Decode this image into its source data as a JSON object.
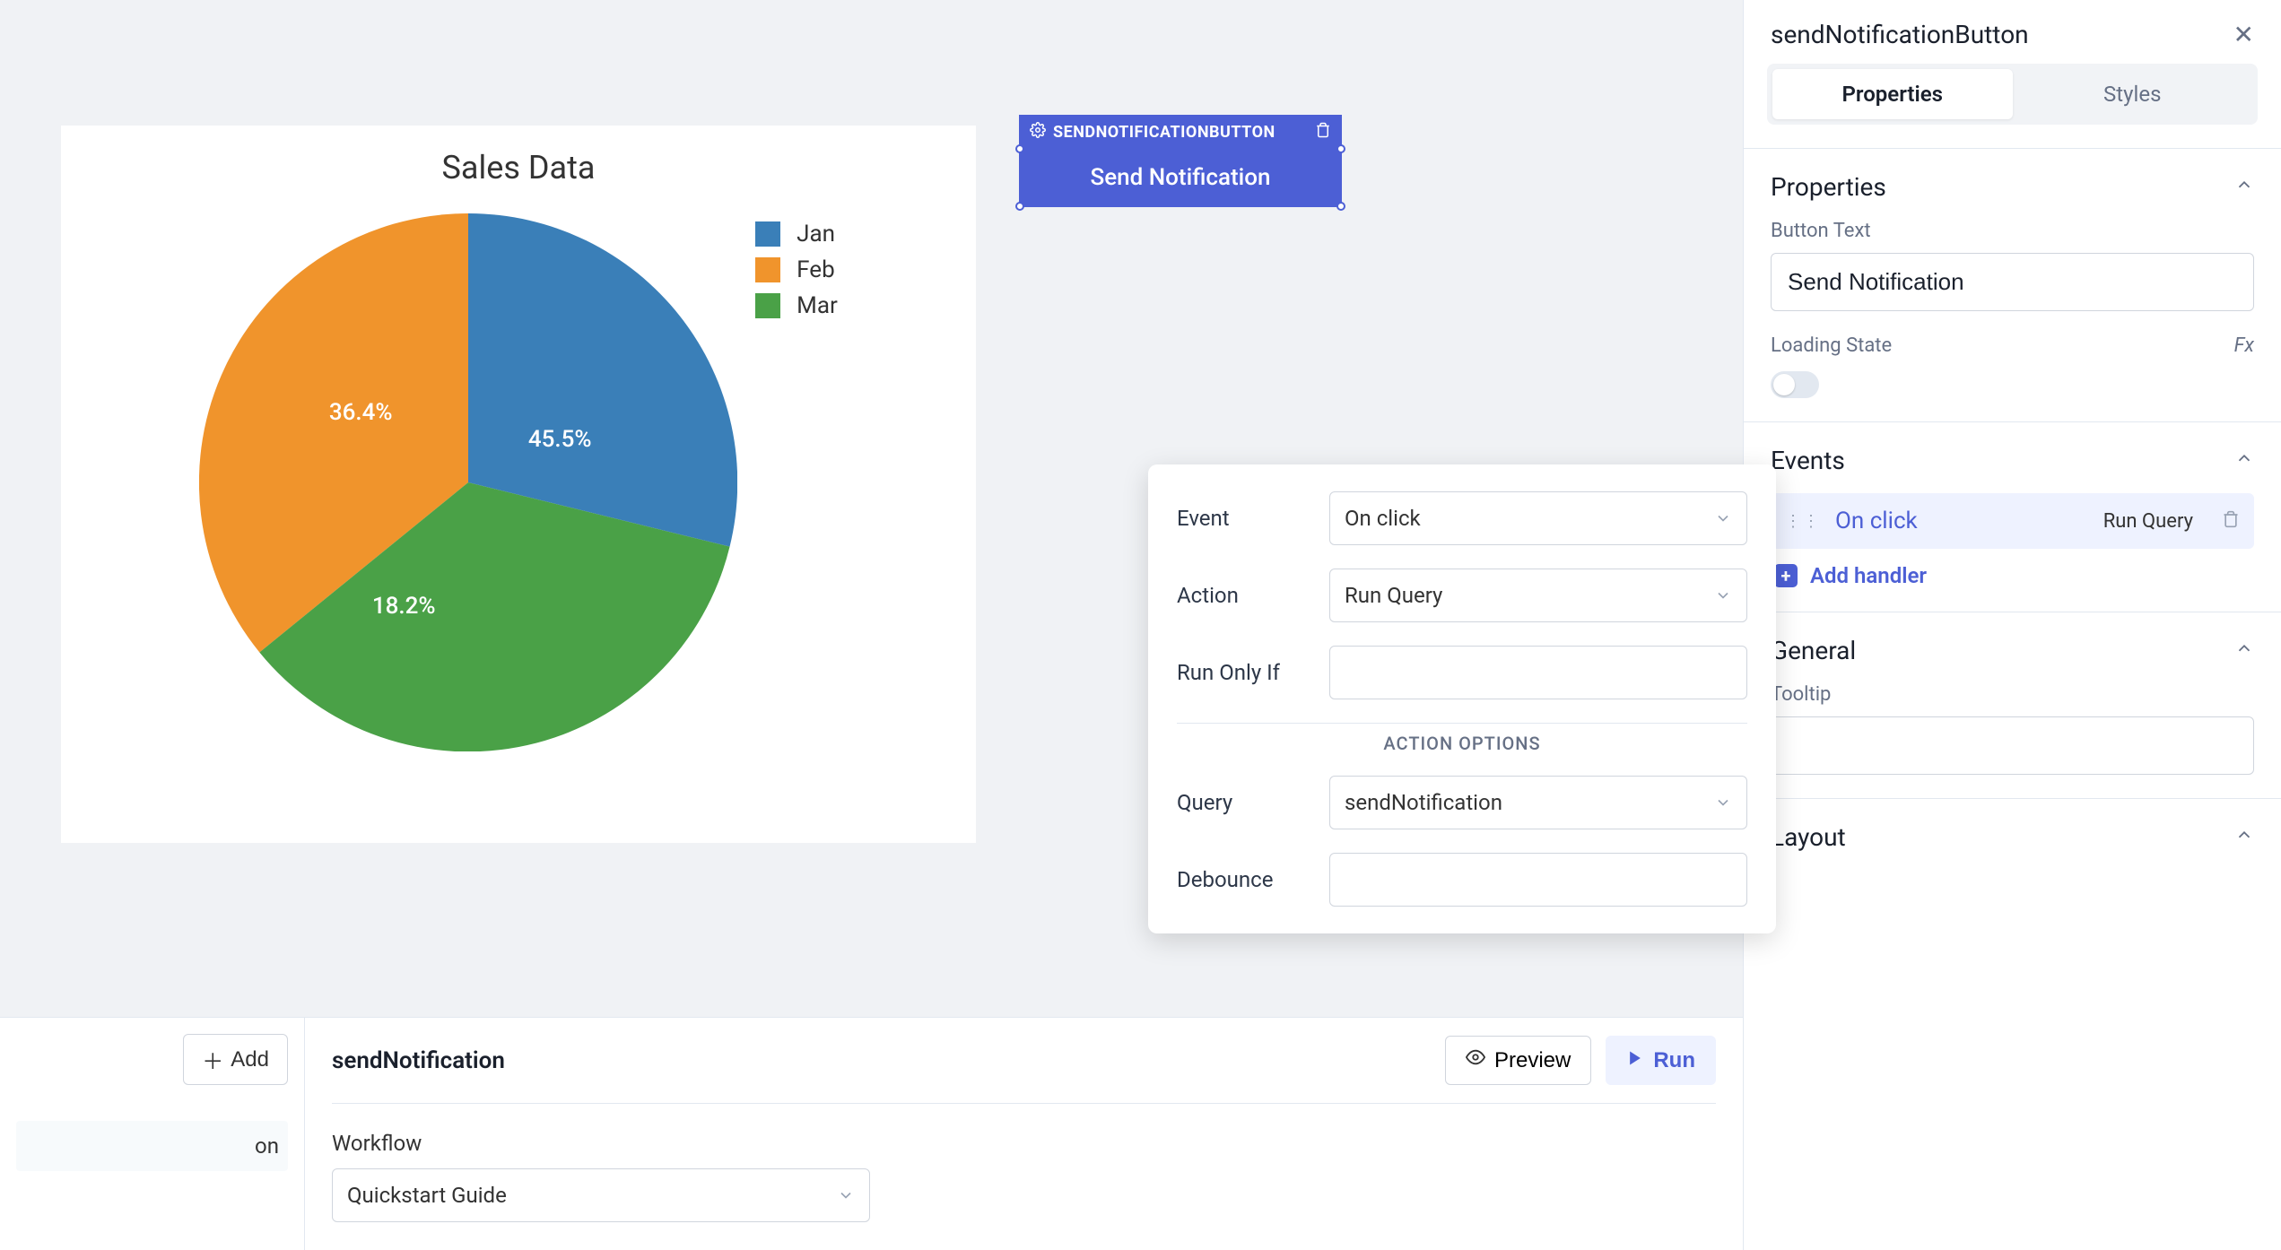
{
  "chart_data": {
    "type": "pie",
    "title": "Sales Data",
    "series": [
      {
        "name": "Jan",
        "value": 45.5,
        "color": "#3a7fb8",
        "label": "45.5%"
      },
      {
        "name": "Feb",
        "value": 36.4,
        "color": "#f0942c",
        "label": "36.4%"
      },
      {
        "name": "Mar",
        "value": 18.2,
        "color": "#4aa147",
        "label": "18.2%"
      }
    ]
  },
  "selected_widget": {
    "tag": "SENDNOTIFICATIONBUTTON",
    "label": "Send Notification"
  },
  "popover": {
    "event_label": "Event",
    "event_value": "On click",
    "action_label": "Action",
    "action_value": "Run Query",
    "run_only_if_label": "Run Only If",
    "run_only_if_value": "",
    "action_options_label": "ACTION OPTIONS",
    "query_label": "Query",
    "query_value": "sendNotification",
    "debounce_label": "Debounce",
    "debounce_value": ""
  },
  "bottom": {
    "add_label": "Add",
    "list_item": "on",
    "query_name": "sendNotification",
    "preview_label": "Preview",
    "run_label": "Run",
    "workflow_label": "Workflow",
    "workflow_value": "Quickstart Guide"
  },
  "sidebar": {
    "title": "sendNotificationButton",
    "tabs": {
      "properties": "Properties",
      "styles": "Styles"
    },
    "properties": {
      "heading": "Properties",
      "button_text_label": "Button Text",
      "button_text_value": "Send Notification",
      "loading_state_label": "Loading State",
      "fx": "Fx"
    },
    "events": {
      "heading": "Events",
      "row": {
        "name": "On click",
        "action": "Run Query"
      },
      "add_handler": "Add handler"
    },
    "general": {
      "heading": "General",
      "tooltip_label": "Tooltip",
      "tooltip_value": ""
    },
    "layout": {
      "heading": "Layout"
    }
  }
}
